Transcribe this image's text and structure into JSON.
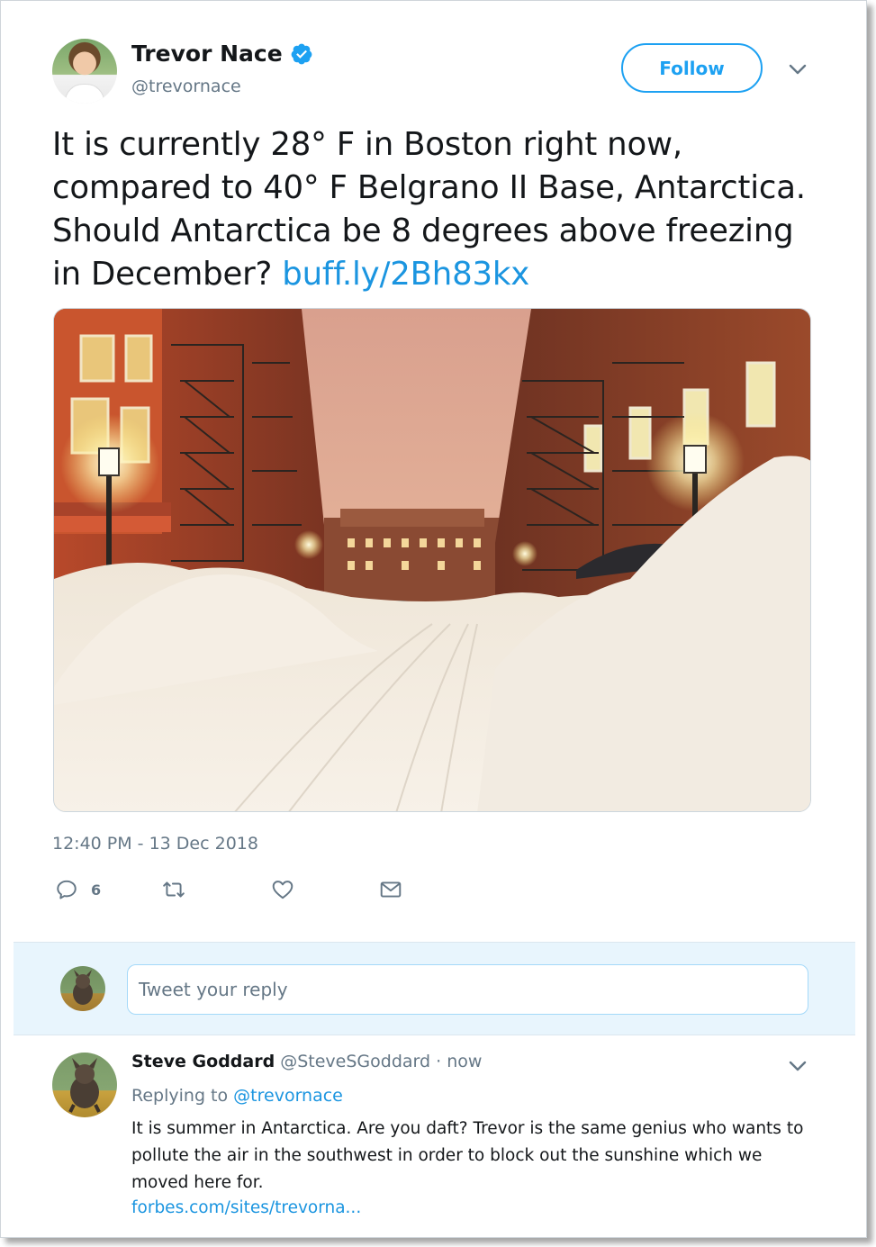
{
  "tweet": {
    "author": {
      "display_name": "Trevor Nace",
      "handle": "@trevornace",
      "verified": true
    },
    "follow_label": "Follow",
    "text": "It is currently 28° F in Boston right now, compared to 40° F Belgrano II Base, Antarctica. Should Antarctica be 8 degrees above freezing in December?",
    "link_text": "buff.ly/2Bh83kx",
    "timestamp": "12:40 PM - 13 Dec 2018",
    "actions": {
      "reply_icon": "reply-icon",
      "reply_count": "6",
      "retweet_icon": "retweet-icon",
      "like_icon": "heart-icon",
      "dm_icon": "envelope-icon"
    }
  },
  "reply_box": {
    "placeholder": "Tweet your reply"
  },
  "reply": {
    "display_name": "Steve Goddard",
    "handle": "@SteveSGoddard",
    "separator": "·",
    "time": "now",
    "replying_prefix": "Replying to",
    "replying_to": "@trevornace",
    "text": "It is summer in Antarctica. Are you daft?  Trevor is the same genius who wants to pollute the air in the southwest in order to block out the sunshine which we moved here for.",
    "link_text": "forbes.com/sites/trevorna..."
  },
  "colors": {
    "accent": "#1da1f2",
    "link": "#1b95e0",
    "secondary_text": "#657786",
    "reply_area_bg": "#e8f5fd"
  }
}
